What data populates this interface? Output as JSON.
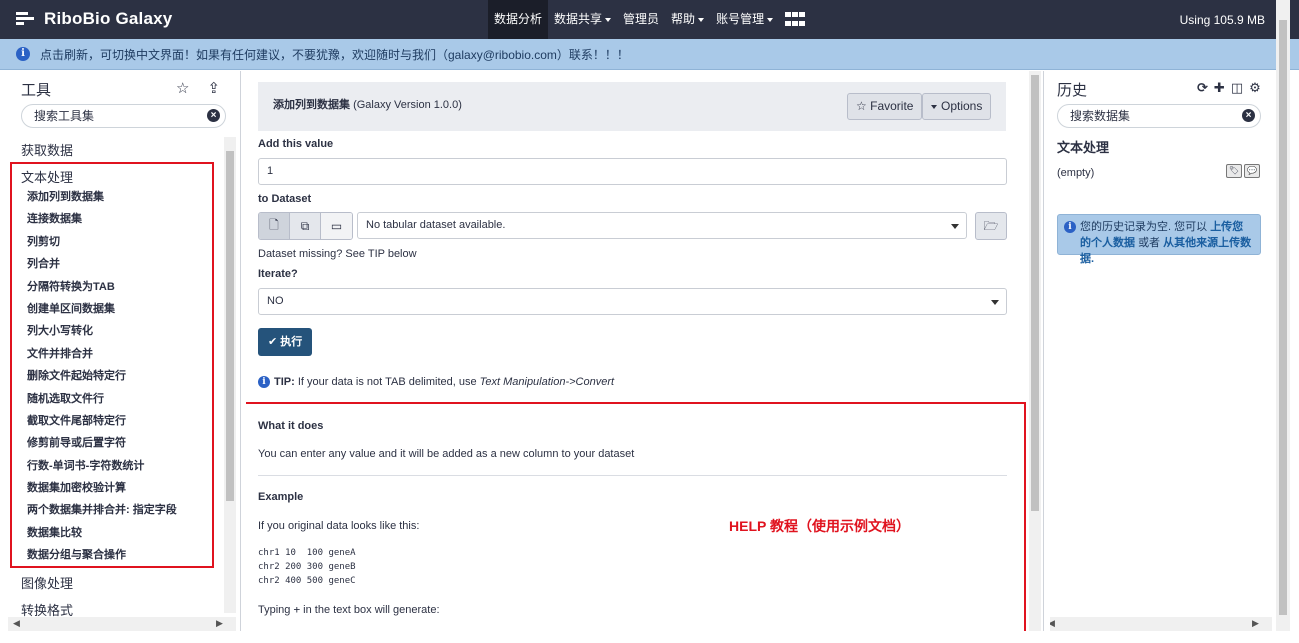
{
  "masthead": {
    "brand": "RiboBio Galaxy",
    "nav": [
      {
        "label": "数据分析",
        "active": true,
        "caret": false
      },
      {
        "label": "数据共享",
        "active": false,
        "caret": true
      },
      {
        "label": "管理员",
        "active": false,
        "caret": false
      },
      {
        "label": "帮助",
        "active": false,
        "caret": true
      },
      {
        "label": "账号管理",
        "active": false,
        "caret": true
      }
    ],
    "apps_icon": "grid-icon",
    "quota": "Using 105.9 MB",
    "colors": {
      "bar": "#2c3143",
      "active": "#1b1e29"
    }
  },
  "notice": {
    "icon": "info-icon",
    "text": "点击刷新，可切换中文界面！如果有任何建议，不要犹豫，欢迎随时与我们（galaxy@ribobio.com）联系！！！",
    "background": "#a9c9e8"
  },
  "tool_panel": {
    "title": "工具",
    "search_placeholder": "搜索工具集",
    "sections": {
      "get_data": "获取数据",
      "text_processing": "文本处理",
      "image_processing": "图像处理",
      "convert_formats": "转换格式"
    },
    "tools": [
      "添加列到数据集",
      "连接数据集",
      "列剪切",
      "列合并",
      "分隔符转换为TAB",
      "创建单区间数据集",
      "列大小写转化",
      "文件并排合并",
      "删除文件起始特定行",
      "随机选取文件行",
      "截取文件尾部特定行",
      "修剪前导或后置字符",
      "行数-单词书-字符数统计",
      "数据集加密校验计算",
      "两个数据集并排合并: 指定字段",
      "数据集比较",
      "数据分组与聚合操作"
    ]
  },
  "tool_form": {
    "tool_name": "添加列到数据集",
    "version": "(Galaxy Version 1.0.0)",
    "favorite_label": "Favorite",
    "options_label": "Options",
    "add_value_label": "Add this value",
    "add_value": "1",
    "dataset_label": "to Dataset",
    "dataset_value": "No tabular dataset available.",
    "dataset_hint": "Dataset missing? See TIP below",
    "iterate_label": "Iterate?",
    "iterate_value": "NO",
    "run_label": "执行",
    "run_color": "#25537b",
    "tip_label": "TIP:",
    "tip_text": "If your data is not TAB delimited, use",
    "tip_tool": "Text Manipulation->Convert"
  },
  "help": {
    "what_title": "What it does",
    "what_text": "You can enter any value and it will be added as a new column to your dataset",
    "example_title": "Example",
    "example_intro": "If you original data looks like this:",
    "example_lines": [
      "chr1 10  100 geneA",
      "chr2 200 300 geneB",
      "chr2 400 500 geneC"
    ],
    "typing_pre": "Typing",
    "typing_value": "+",
    "typing_post": "in the text box will generate:",
    "annotation": "HELP 教程（使用示例文档）",
    "annotation_color": "#e0131f"
  },
  "history": {
    "title": "历史",
    "search_placeholder": "搜索数据集",
    "name": "文本处理",
    "empty_label": "(empty)",
    "info_text_1": "您的历史记录为空. 您可以",
    "info_link_1": "上传您的个人数据",
    "info_text_2": "或者",
    "info_link_2": "从其他来源上传数据."
  }
}
